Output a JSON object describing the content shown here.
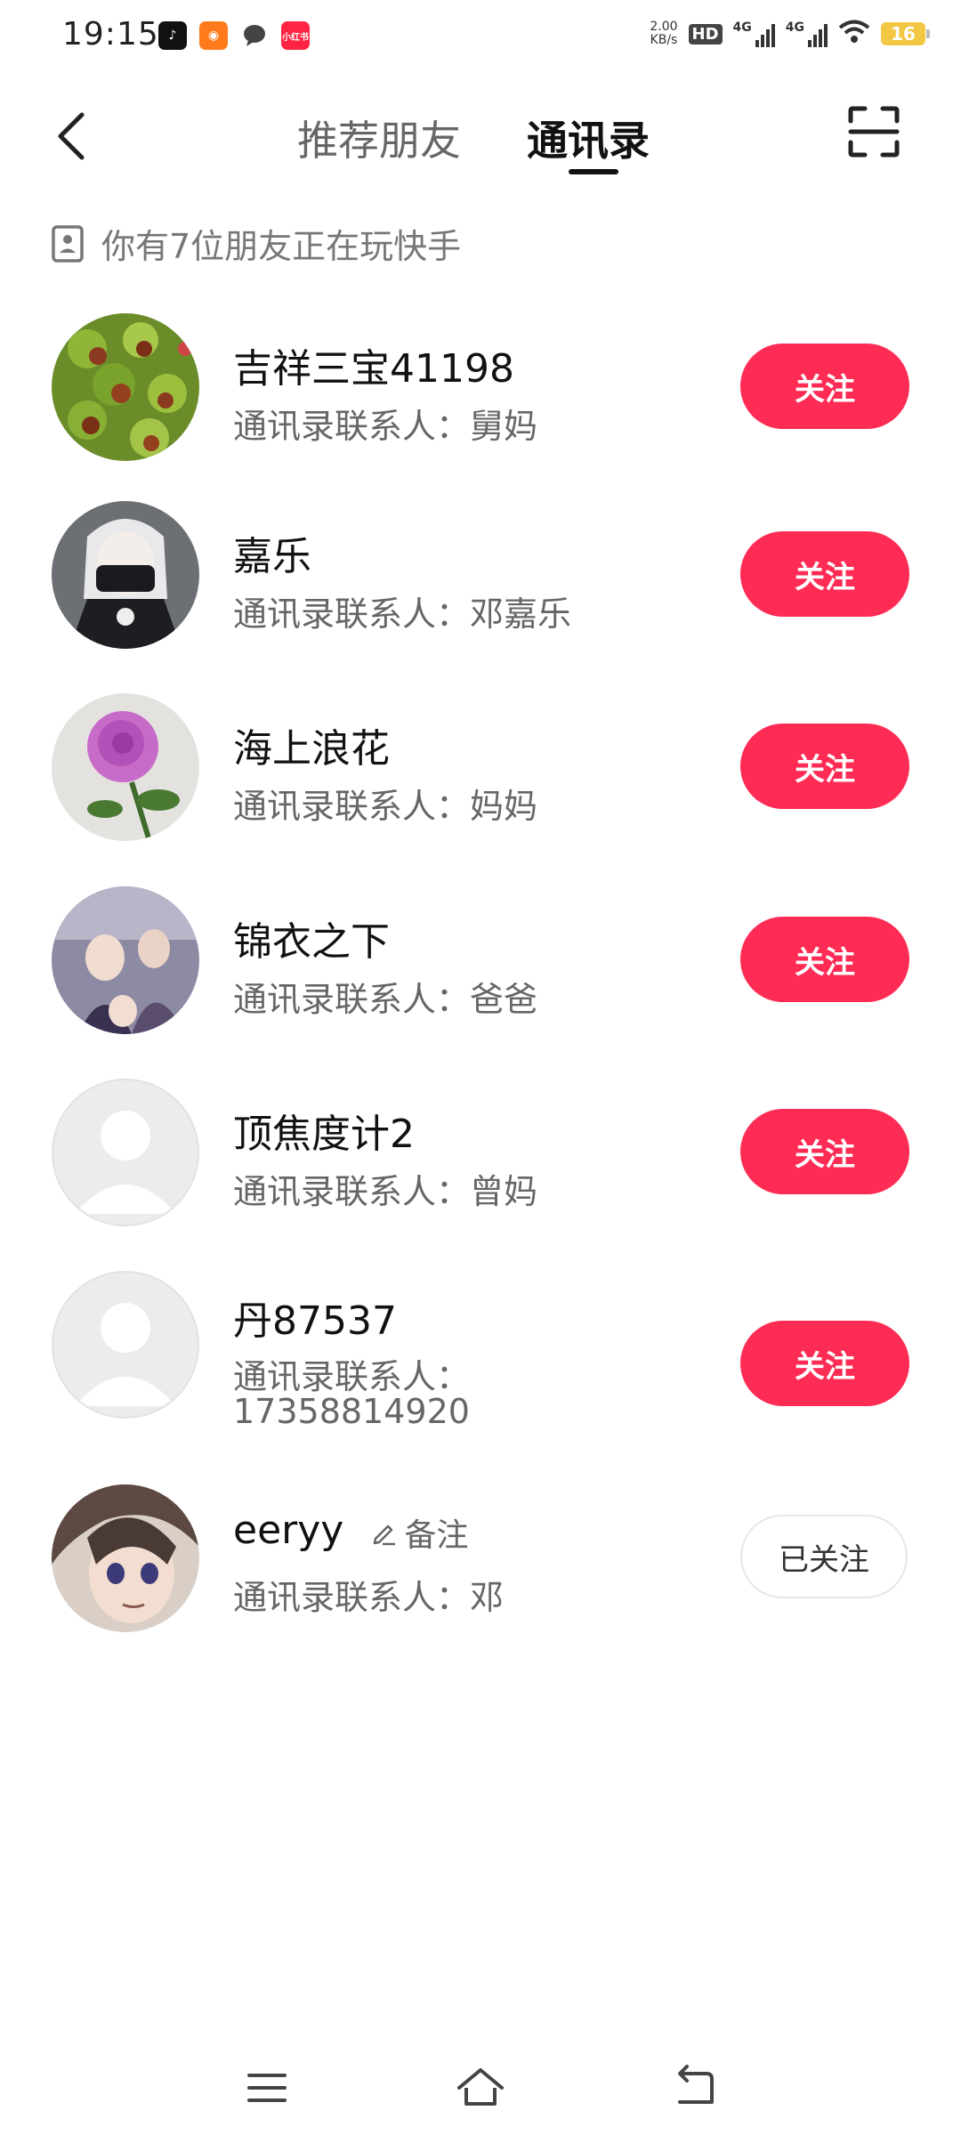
{
  "status_bar": {
    "time": "19:15",
    "notifications": [
      "tiktok-app",
      "kuaishou-app",
      "message-app",
      "xiaohongshu-app"
    ],
    "net_speed_value": "2.00",
    "net_speed_unit": "KB/s",
    "hd_label": "HD",
    "signal_1_label": "4G",
    "signal_2_label": "4G",
    "battery": "16"
  },
  "header": {
    "tabs": [
      {
        "label": "推荐朋友",
        "active": false
      },
      {
        "label": "通讯录",
        "active": true
      }
    ]
  },
  "info": {
    "text": "你有7位朋友正在玩快手"
  },
  "contacts": [
    {
      "name": "吉祥三宝41198",
      "subtitle": "通讯录联系人：舅妈",
      "button": "关注",
      "followed": false
    },
    {
      "name": "嘉乐",
      "subtitle": "通讯录联系人：邓嘉乐",
      "button": "关注",
      "followed": false
    },
    {
      "name": "海上浪花",
      "subtitle": "通讯录联系人：妈妈",
      "button": "关注",
      "followed": false
    },
    {
      "name": "锦衣之下",
      "subtitle": "通讯录联系人：爸爸",
      "button": "关注",
      "followed": false
    },
    {
      "name": "顶焦度计2",
      "subtitle": "通讯录联系人：曾妈",
      "button": "关注",
      "followed": false
    },
    {
      "name": "丹87537",
      "subtitle_line1": "通讯录联系人：",
      "subtitle_line2": "17358814920",
      "button": "关注",
      "followed": false
    },
    {
      "name": "eeryy",
      "remark": "备注",
      "subtitle": "通讯录联系人：邓",
      "button": "已关注",
      "followed": true
    }
  ],
  "colors": {
    "accent": "#fe2c55",
    "text_primary": "#111111",
    "text_secondary": "#666666"
  }
}
